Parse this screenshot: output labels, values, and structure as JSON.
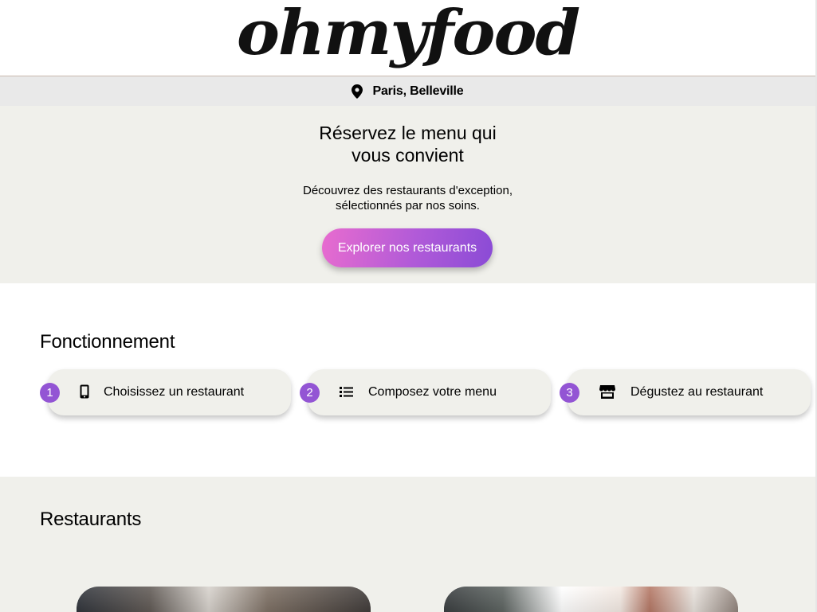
{
  "header": {
    "logo_text": "ohmyfood"
  },
  "location": {
    "icon": "map-pin-icon",
    "text": "Paris, Belleville"
  },
  "hero": {
    "title_line1": "Réservez le menu qui",
    "title_line2": "vous convient",
    "subtitle_line1": "Découvrez des restaurants d'exception,",
    "subtitle_line2": "sélectionnés par nos soins.",
    "cta_label": "Explorer nos restaurants"
  },
  "how_it_works": {
    "title": "Fonctionnement",
    "steps": [
      {
        "number": "1",
        "icon": "smartphone-icon",
        "label": "Choisissez un restaurant"
      },
      {
        "number": "2",
        "icon": "list-icon",
        "label": "Composez votre menu"
      },
      {
        "number": "3",
        "icon": "store-icon",
        "label": "Dégustez au restaurant"
      }
    ]
  },
  "restaurants": {
    "title": "Restaurants"
  },
  "colors": {
    "accent_gradient_start": "#e86ccf",
    "accent_gradient_end": "#8a4bd6",
    "step_number_bg": "#9355d4",
    "section_bg": "#f0f0eb",
    "location_bar_bg": "#e9e9e9"
  }
}
